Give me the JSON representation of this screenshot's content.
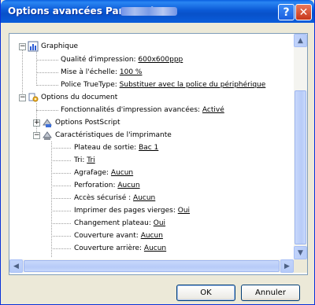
{
  "window": {
    "title": "Options avancées Panasonic",
    "help_label": "?",
    "close_label": "✕"
  },
  "tree": {
    "graphique": {
      "label": "Graphique",
      "quality": {
        "label": "Qualité d'impression: ",
        "value": "600x600ppp"
      },
      "scale": {
        "label": "Mise à l'échelle: ",
        "value": "100 %"
      },
      "truetype": {
        "label": "Police TrueType: ",
        "value": "Substituer avec la police du périphérique"
      }
    },
    "document": {
      "label": "Options du document",
      "advanced": {
        "label": "Fonctionnalités d'impression avancées: ",
        "value": "Activé"
      },
      "postscript": {
        "label": "Options PostScript"
      },
      "printer": {
        "label": "Caractéristiques de l'imprimante",
        "items": [
          {
            "label": "Plateau de sortie: ",
            "value": "Bac 1"
          },
          {
            "label": "Tri: ",
            "value": "Tri"
          },
          {
            "label": "Agrafage: ",
            "value": "Aucun"
          },
          {
            "label": "Perforation: ",
            "value": "Aucun"
          },
          {
            "label": "Accès sécurisé : ",
            "value": "Aucun"
          },
          {
            "label": "Imprimer des pages vierges: ",
            "value": "Oui"
          },
          {
            "label": "Changement plateau: ",
            "value": "Oui"
          },
          {
            "label": "Couverture avant: ",
            "value": "Aucun"
          },
          {
            "label": "Couverture arrière: ",
            "value": "Aucun"
          }
        ]
      }
    }
  },
  "buttons": {
    "ok": "OK",
    "cancel": "Annuler"
  }
}
